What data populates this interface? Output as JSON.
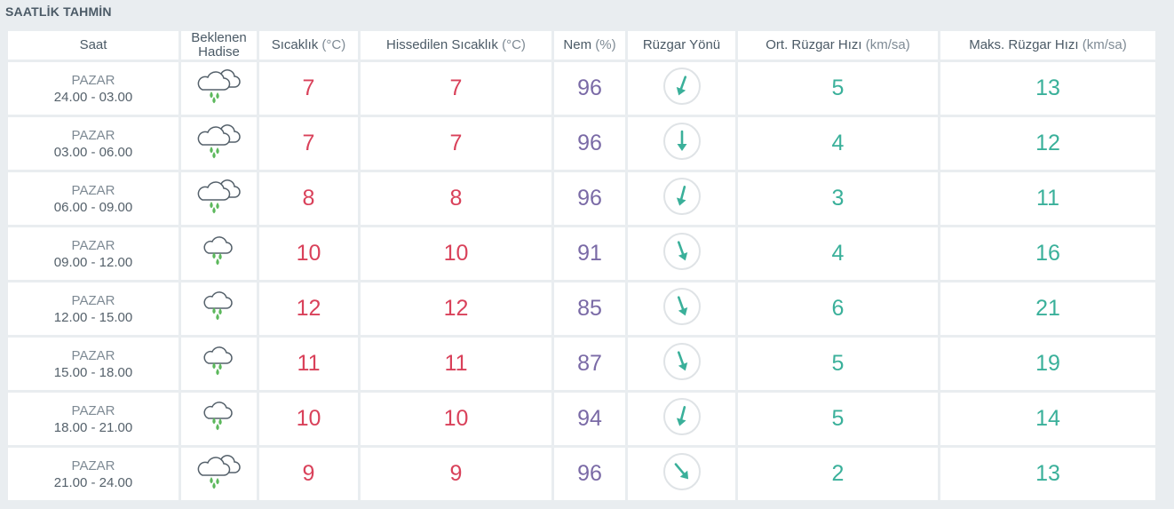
{
  "section": {
    "title": "SAATLİK TAHMİN"
  },
  "headers": {
    "time": "Saat",
    "event_line1": "Beklenen",
    "event_line2": "Hadise",
    "temp_label": "Sıcaklık",
    "temp_unit": "(°C)",
    "feels_label": "Hissedilen Sıcaklık",
    "feels_unit": "(°C)",
    "humidity_label": "Nem",
    "humidity_unit": "(%)",
    "wind_dir_label": "Rüzgar Yönü",
    "wind_avg_label": "Ort. Rüzgar Hızı",
    "wind_avg_unit": "(km/sa)",
    "wind_max_label": "Maks. Rüzgar Hızı",
    "wind_max_unit": "(km/sa)"
  },
  "colors": {
    "temperature": "#d9415a",
    "humidity": "#7a6aa6",
    "wind": "#3ab09a",
    "icon_cloud": "#55616b",
    "icon_rain": "#5cb85c",
    "compass_ring": "#dfe3e6"
  },
  "rows": [
    {
      "day": "PAZAR",
      "range": "24.00 - 03.00",
      "icon": "cloudy-rain-icon",
      "temp": "7",
      "feels": "7",
      "humidity": "96",
      "wind_dir_deg": 20,
      "wind_avg": "5",
      "wind_max": "13"
    },
    {
      "day": "PAZAR",
      "range": "03.00 - 06.00",
      "icon": "cloudy-rain-icon",
      "temp": "7",
      "feels": "7",
      "humidity": "96",
      "wind_dir_deg": 0,
      "wind_avg": "4",
      "wind_max": "12"
    },
    {
      "day": "PAZAR",
      "range": "06.00 - 09.00",
      "icon": "cloudy-rain-icon",
      "temp": "8",
      "feels": "8",
      "humidity": "96",
      "wind_dir_deg": 15,
      "wind_avg": "3",
      "wind_max": "11"
    },
    {
      "day": "PAZAR",
      "range": "09.00 - 12.00",
      "icon": "rain-icon",
      "temp": "10",
      "feels": "10",
      "humidity": "91",
      "wind_dir_deg": -20,
      "wind_avg": "4",
      "wind_max": "16"
    },
    {
      "day": "PAZAR",
      "range": "12.00 - 15.00",
      "icon": "rain-icon",
      "temp": "12",
      "feels": "12",
      "humidity": "85",
      "wind_dir_deg": -20,
      "wind_avg": "6",
      "wind_max": "21"
    },
    {
      "day": "PAZAR",
      "range": "15.00 - 18.00",
      "icon": "rain-icon",
      "temp": "11",
      "feels": "11",
      "humidity": "87",
      "wind_dir_deg": -20,
      "wind_avg": "5",
      "wind_max": "19"
    },
    {
      "day": "PAZAR",
      "range": "18.00 - 21.00",
      "icon": "rain-icon",
      "temp": "10",
      "feels": "10",
      "humidity": "94",
      "wind_dir_deg": 15,
      "wind_avg": "5",
      "wind_max": "14"
    },
    {
      "day": "PAZAR",
      "range": "21.00 - 24.00",
      "icon": "cloudy-rain-icon",
      "temp": "9",
      "feels": "9",
      "humidity": "96",
      "wind_dir_deg": -40,
      "wind_avg": "2",
      "wind_max": "13"
    }
  ]
}
